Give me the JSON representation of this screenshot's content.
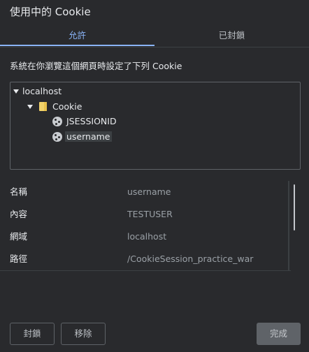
{
  "dialog": {
    "title": "使用中的 Cookie"
  },
  "tabs": [
    {
      "label": "允許",
      "active": true
    },
    {
      "label": "已封鎖",
      "active": false
    }
  ],
  "description": "系統在你瀏覽這個網頁時設定了下列 Cookie",
  "tree": {
    "site": "localhost",
    "folder": "Cookie",
    "cookies": [
      "JSESSIONID",
      "username"
    ],
    "selected": "username"
  },
  "details": [
    {
      "key": "名稱",
      "value": "username"
    },
    {
      "key": "內容",
      "value": "TESTUSER"
    },
    {
      "key": "網域",
      "value": "localhost"
    },
    {
      "key": "路徑",
      "value": "/CookieSession_practice_war"
    }
  ],
  "buttons": {
    "block": "封鎖",
    "remove": "移除",
    "done": "完成"
  }
}
